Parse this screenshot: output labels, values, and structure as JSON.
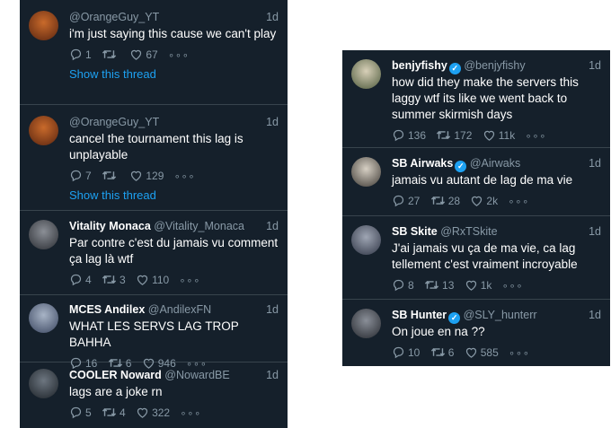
{
  "left_tweets": [
    {
      "name": "",
      "handle": "@OrangeGuy_YT",
      "time": "1d",
      "text": "i'm just saying this cause we can't play",
      "replies": "1",
      "retweets": "",
      "likes": "67",
      "show_thread": "Show this thread"
    },
    {
      "name": "",
      "handle": "@OrangeGuy_YT",
      "time": "1d",
      "text": "cancel the tournament this lag is unplayable",
      "replies": "7",
      "retweets": "",
      "likes": "129",
      "show_thread": "Show this thread"
    },
    {
      "name": "Vitality Monaca",
      "handle": "@Vitality_Monaca",
      "time": "1d",
      "text": "Par contre c'est du jamais vu comment ça lag là wtf",
      "replies": "4",
      "retweets": "3",
      "likes": "110"
    },
    {
      "name": "MCES Andilex",
      "handle": "@AndilexFN",
      "time": "1d",
      "text": "WHAT LES SERVS LAG TROP BAHHA",
      "replies": "16",
      "retweets": "6",
      "likes": "946"
    },
    {
      "name": "COOLER Noward",
      "handle": "@NowardBE",
      "time": "1d",
      "text": "lags are a joke rn",
      "replies": "5",
      "retweets": "4",
      "likes": "322"
    }
  ],
  "right_tweets": [
    {
      "name": "benjyfishy",
      "verified": true,
      "handle": "@benjyfishy",
      "time": "1d",
      "text": "how did they make the servers this laggy wtf its like we went back to summer skirmish days",
      "replies": "136",
      "retweets": "172",
      "likes": "11k"
    },
    {
      "name": "SB Airwaks",
      "verified": true,
      "handle": "@Airwaks",
      "time": "1d",
      "text": "jamais vu autant de lag de ma vie",
      "replies": "27",
      "retweets": "28",
      "likes": "2k"
    },
    {
      "name": "SB Skite",
      "verified": false,
      "handle": "@RxTSkite",
      "time": "1d",
      "text": "J'ai jamais vu ça de ma vie, ca lag tellement c'est vraiment incroyable",
      "replies": "8",
      "retweets": "13",
      "likes": "1k"
    },
    {
      "name": "SB Hunter",
      "verified": true,
      "handle": "@SLY_hunterr",
      "time": "1d",
      "text": "On joue en na ??",
      "replies": "10",
      "retweets": "6",
      "likes": "585"
    }
  ],
  "more_glyph": "∘∘∘",
  "verified_glyph": "✓",
  "colors": {
    "background": "#15202b",
    "divider": "#38444d",
    "muted": "#8899a6",
    "link": "#1da1f2"
  }
}
